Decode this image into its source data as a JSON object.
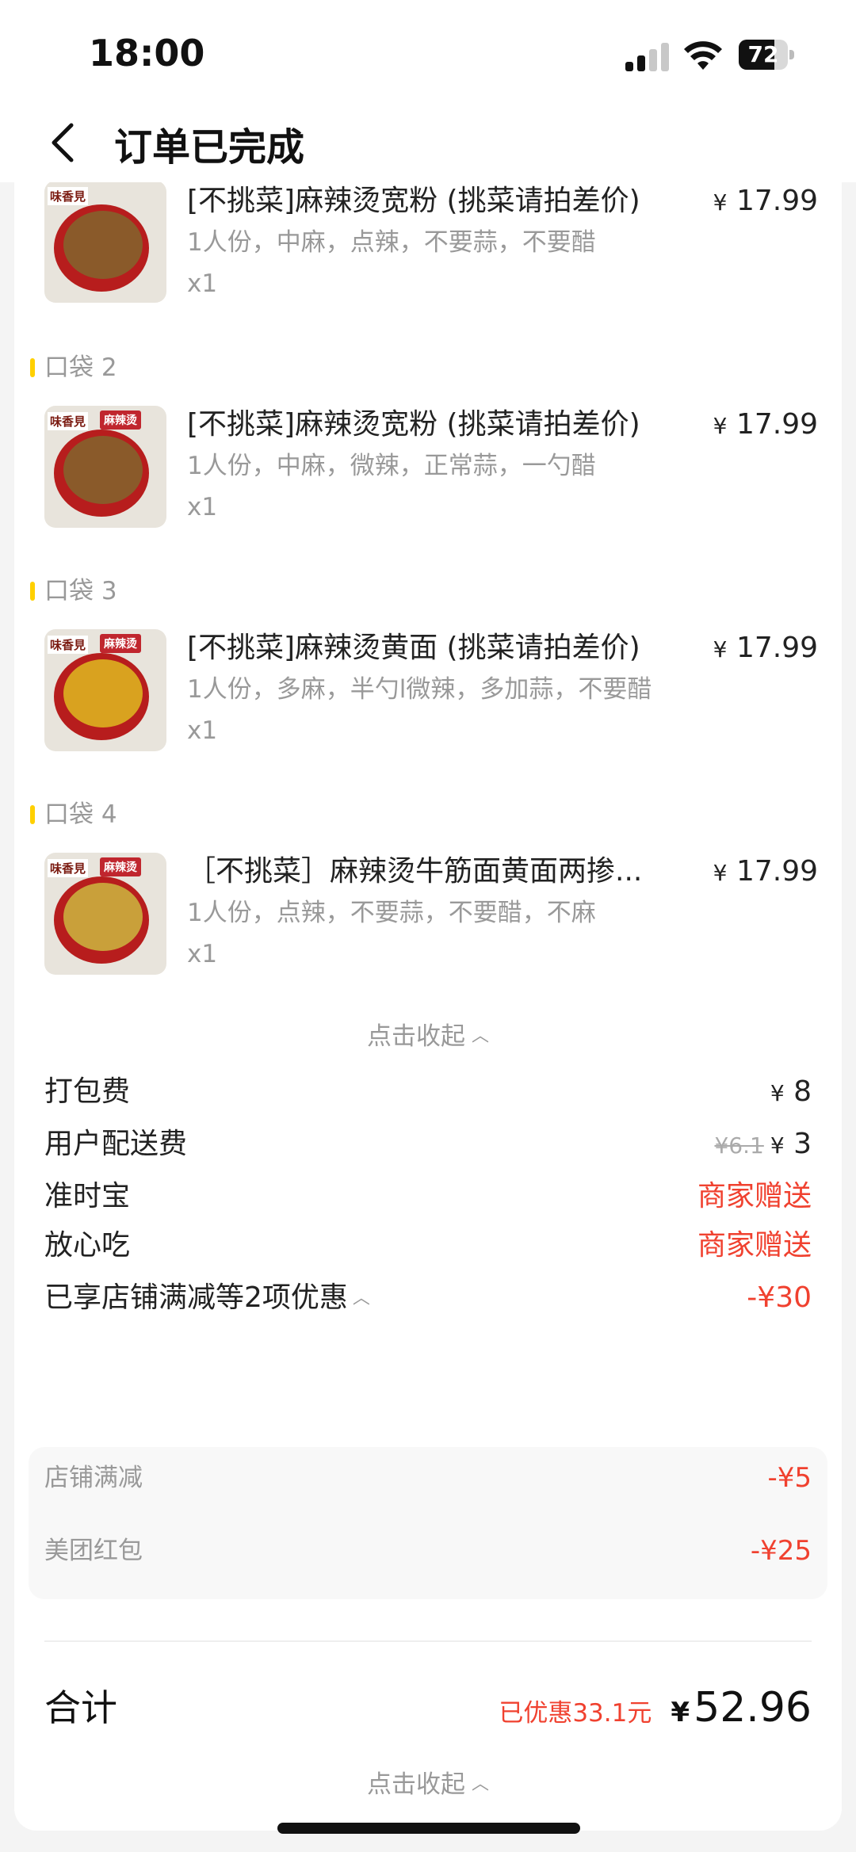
{
  "status_bar": {
    "time": "18:00",
    "battery": "72",
    "battery_level": 0.72
  },
  "nav": {
    "title": "订单已完成"
  },
  "items": [
    {
      "bag": "",
      "name": "[不挑菜]麻辣烫宽粉 (挑菜请拍差价)",
      "spec": "1人份，中麻，点辣，不要蒜，不要醋",
      "qty": "x1",
      "price": "17.99",
      "price_prefix": "¥"
    },
    {
      "bag": "口袋 2",
      "name": "[不挑菜]麻辣烫宽粉 (挑菜请拍差价)",
      "spec": "1人份，中麻，微辣，正常蒜，一勺醋",
      "qty": "x1",
      "price": "17.99",
      "price_prefix": "¥"
    },
    {
      "bag": "口袋 3",
      "name": "[不挑菜]麻辣烫黄面 (挑菜请拍差价)",
      "spec": "1人份，多麻，半勺l微辣，多加蒜，不要醋",
      "qty": "x1",
      "price": "17.99",
      "price_prefix": "¥"
    },
    {
      "bag": "口袋 4",
      "name": "［不挑菜］麻辣烫牛筋面黄面两掺...",
      "spec": "1人份，点辣，不要蒜，不要醋，不麻",
      "qty": "x1",
      "price": "17.99",
      "price_prefix": "¥"
    }
  ],
  "thumb": {
    "logo": "味香見",
    "tag": "麻辣烫"
  },
  "collapse_label": "点击收起",
  "fees": {
    "packing": {
      "label": "打包费",
      "yen": "¥",
      "value": "8"
    },
    "delivery": {
      "label": "用户配送费",
      "original": "¥6.1",
      "yen": "¥",
      "value": "3"
    },
    "ontime": {
      "label": "准时宝",
      "value": "商家赠送"
    },
    "safe": {
      "label": "放心吃",
      "value": "商家赠送"
    }
  },
  "discounts": {
    "label": "已享店铺满减等2项优惠",
    "total": "-¥30",
    "items": [
      {
        "label": "店铺满减",
        "value": "-¥5"
      },
      {
        "label": "美团红包",
        "value": "-¥25"
      }
    ]
  },
  "total": {
    "label": "合计",
    "saved": "已优惠33.1元",
    "yen": "¥",
    "value": "52.96"
  },
  "colors": {
    "accent_red": "#f0412f",
    "bag_yellow": "#ffd000"
  }
}
